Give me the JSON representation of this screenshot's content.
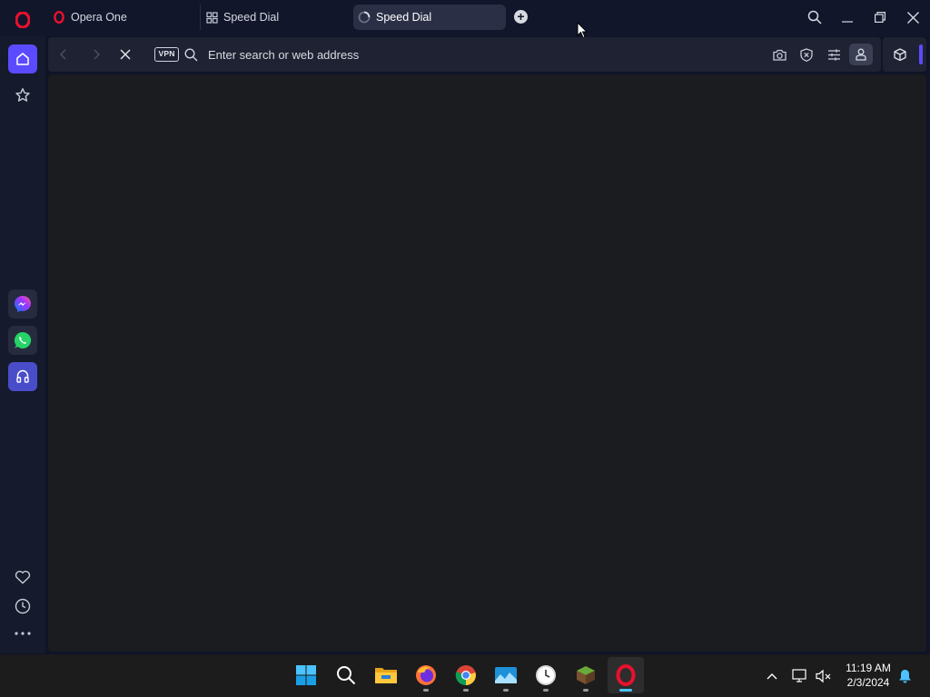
{
  "tabs": [
    {
      "label": "Opera One",
      "icon": "opera-logo-icon"
    },
    {
      "label": "Speed Dial",
      "icon": "speed-dial-grid-icon"
    },
    {
      "label": "Speed Dial",
      "icon": "loading-spinner-icon",
      "active": true
    }
  ],
  "address_bar": {
    "placeholder": "Enter search or web address",
    "vpn_label": "VPN"
  },
  "sidebar": {
    "top_items": [
      "home-icon",
      "star-bookmarks-icon"
    ],
    "apps": [
      "messenger-icon",
      "whatsapp-icon",
      "music-player-icon"
    ],
    "bottom_items": [
      "heart-icon",
      "history-clock-icon",
      "more-icon"
    ]
  },
  "taskbar": {
    "apps": [
      "windows-start-icon",
      "search-icon",
      "file-explorer-icon",
      "firefox-icon",
      "chrome-icon",
      "photos-icon",
      "clock-app-icon",
      "minecraft-icon",
      "opera-icon"
    ],
    "time": "11:19 AM",
    "date": "2/3/2024"
  },
  "colors": {
    "accent": "#5b4bff",
    "opera_red": "#e8112d",
    "background": "#11162b",
    "page": "#1b1c20"
  }
}
